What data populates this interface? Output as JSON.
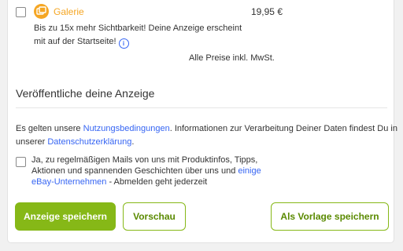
{
  "upgrade": {
    "name": "Galerie",
    "price": "19,95 €",
    "description_line1": "Bis zu 15x mehr Sichtbarkeit! Deine Anzeige erscheint",
    "description_line2": "mit auf der Startseite!",
    "info_glyph": "i",
    "icon": "gallery-icon",
    "accent_color": "#f5a623"
  },
  "prices_note": "Alle Preise inkl. MwSt.",
  "publish": {
    "heading": "Veröffentliche deine Anzeige",
    "terms_part1": "Es gelten unsere ",
    "terms_link": "Nutzungsbedingungen",
    "terms_part2": ". Informationen zur Verarbeitung Deiner Daten findest Du in",
    "terms_part3": "unserer ",
    "privacy_link": "Datenschutzerklärung",
    "terms_part4": "."
  },
  "newsletter": {
    "line1": "Ja, zu regelmäßigen Mails von uns mit Produktinfos, Tipps,",
    "line2_text": "Aktionen und spannenden Geschichten über uns und ",
    "line2_link": "einige",
    "line3_link": "eBay-Unternehmen",
    "line3_text": " - Abmelden geht jederzeit"
  },
  "buttons": {
    "save": "Anzeige speichern",
    "preview": "Vorschau",
    "save_template": "Als Vorlage speichern"
  },
  "colors": {
    "primary_green": "#86b817",
    "link_blue": "#3665f3"
  }
}
